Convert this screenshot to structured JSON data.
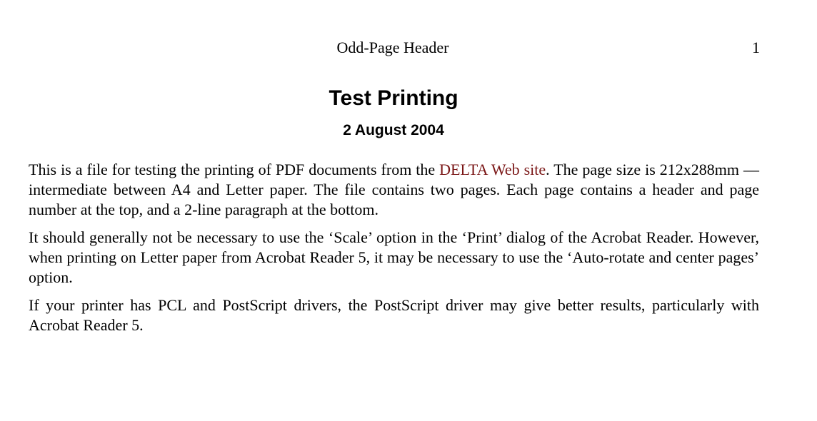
{
  "header": {
    "title": "Odd-Page Header",
    "page_number": "1"
  },
  "document": {
    "title": "Test Printing",
    "date": "2 August 2004"
  },
  "paragraphs": {
    "p1": {
      "before_link": "This is a file for testing the printing of PDF documents from the ",
      "link_text": "DELTA Web site",
      "after_link": ". The page size is 212x288mm — intermediate between A4 and Letter paper. The file contains two pages. Each page contains a header and page number at the top, and a 2-line paragraph at the bottom."
    },
    "p2": "It should generally not be necessary to use the ‘Scale’ option in the ‘Print’ dialog of the Acrobat Reader. However, when printing on Letter paper from Acrobat Reader 5, it may be necessary to use the ‘Auto-rotate and center pages’ option.",
    "p3": "If your printer has PCL and PostScript drivers, the PostScript driver may give better results, particularly with Acrobat Reader 5."
  },
  "colors": {
    "link": "#7a1616",
    "text": "#000000",
    "background": "#ffffff"
  }
}
